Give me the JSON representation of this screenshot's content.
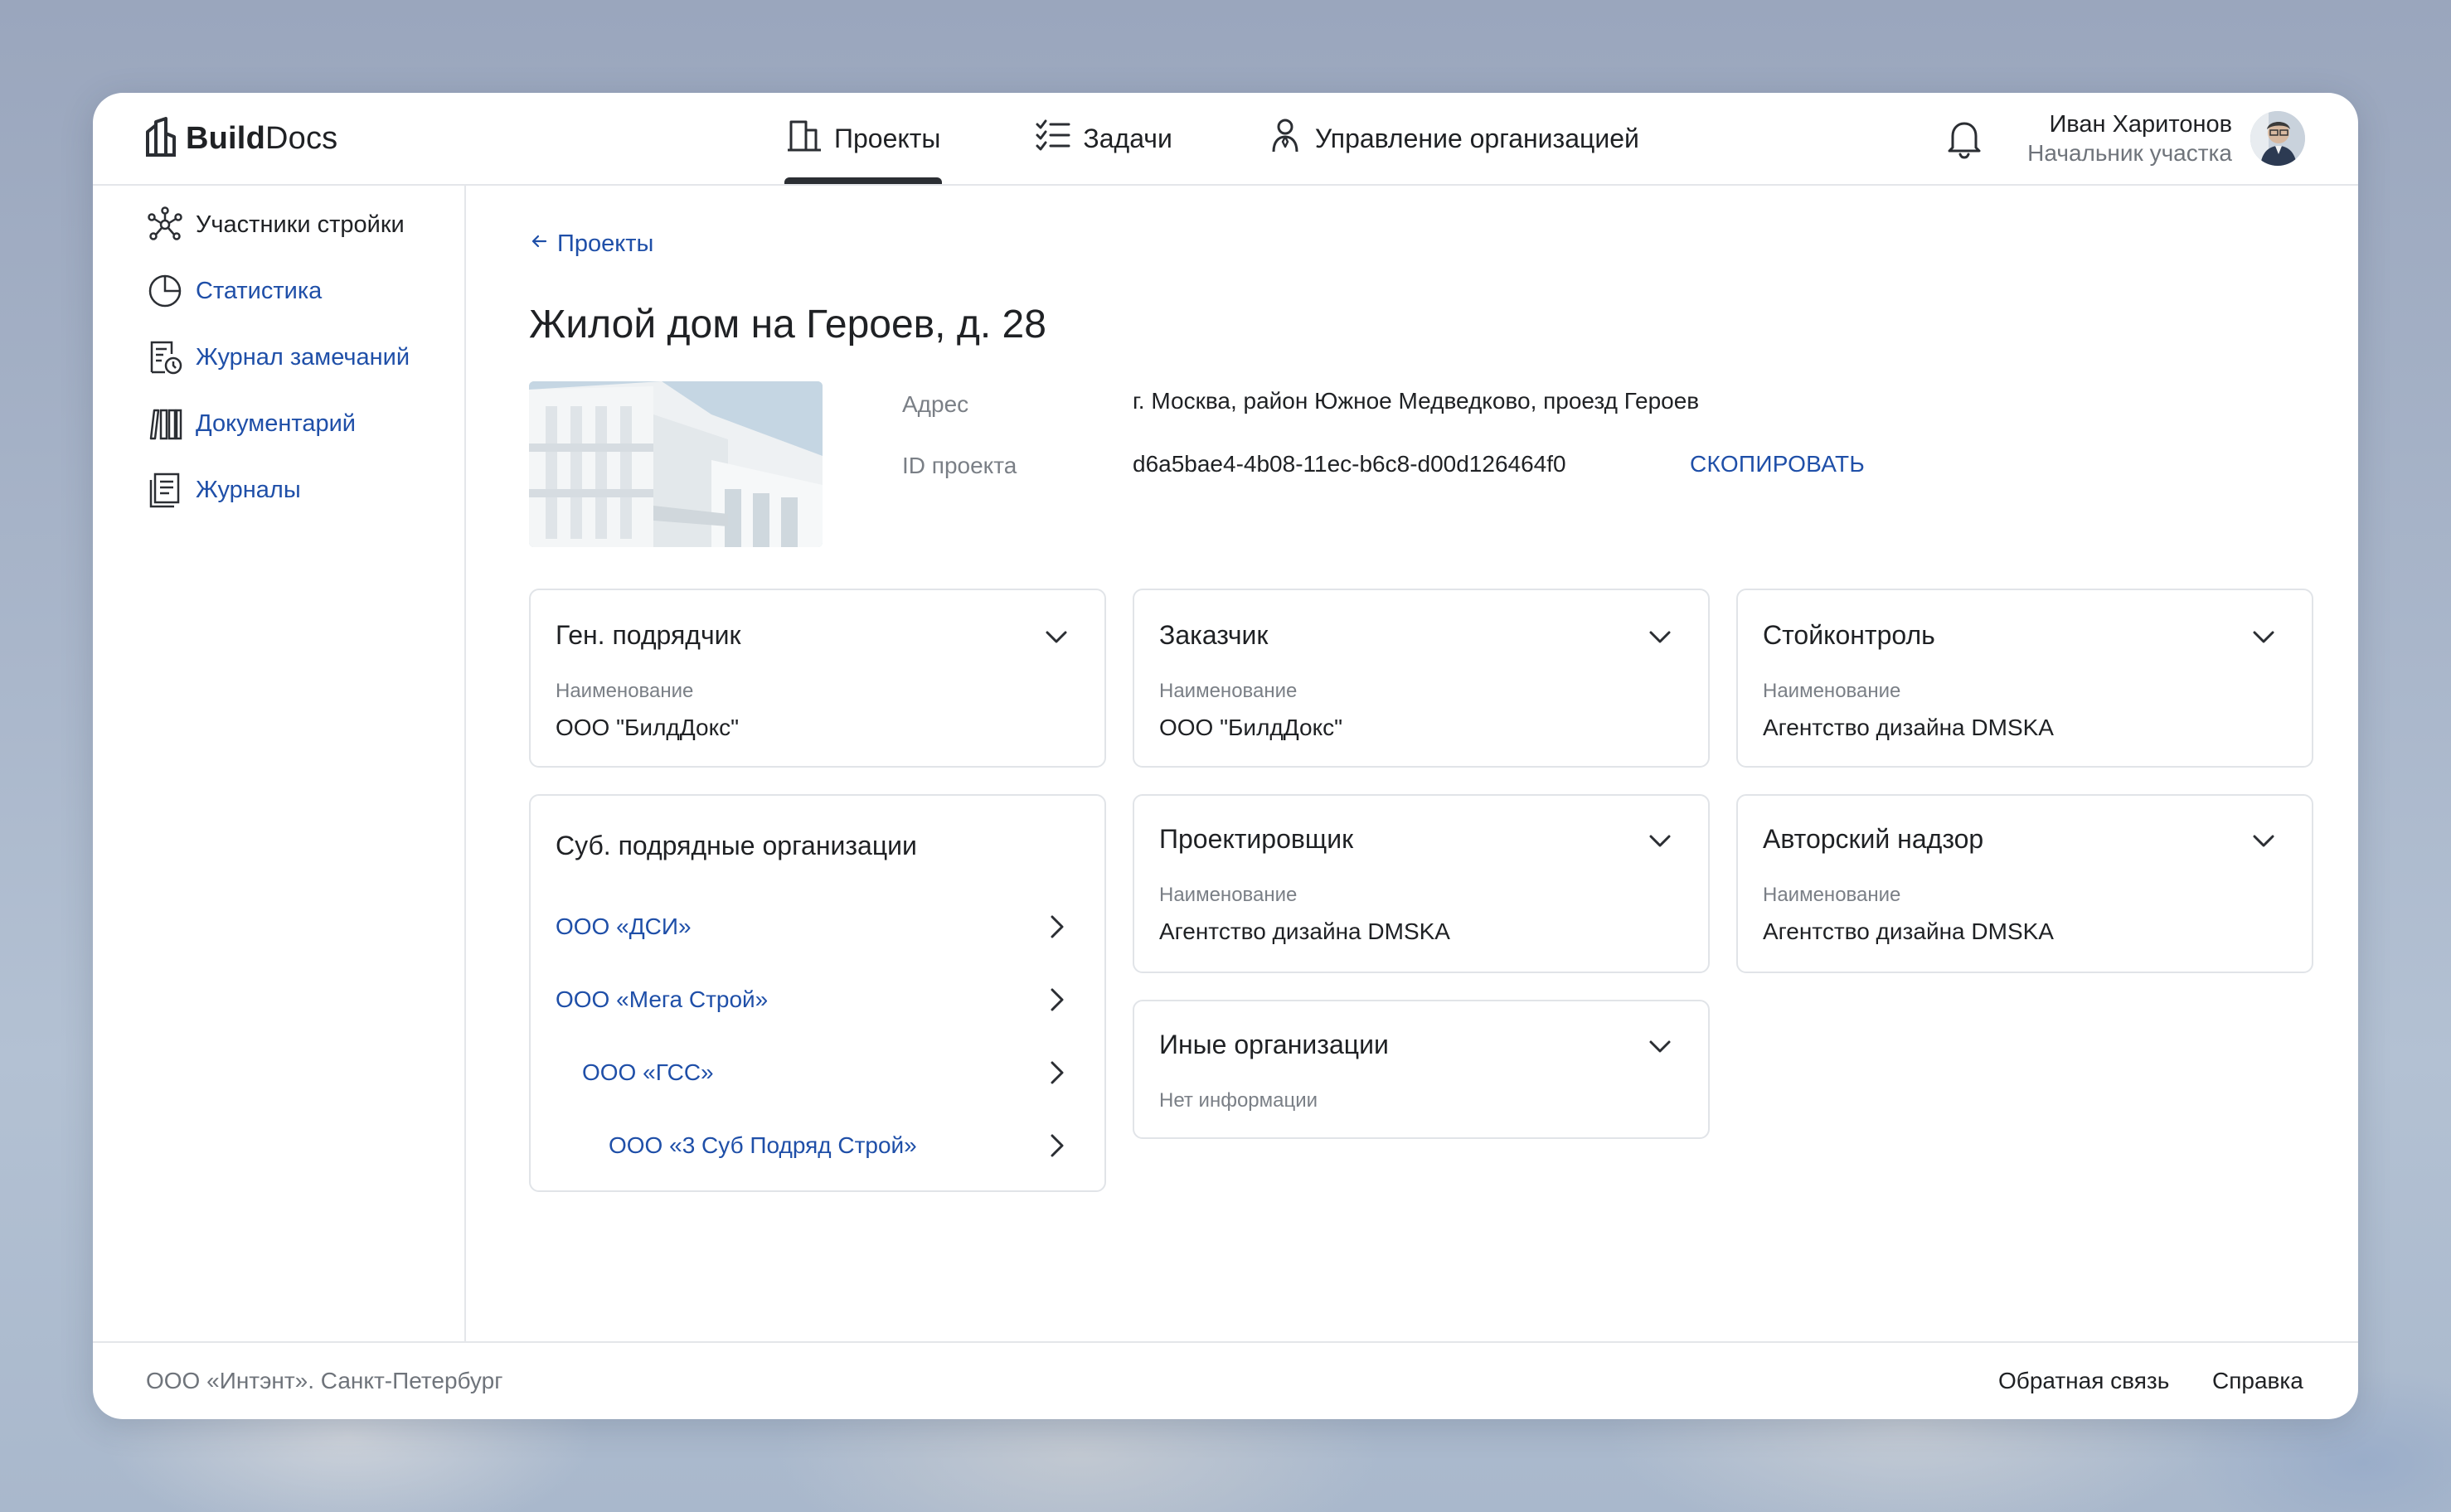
{
  "app": {
    "logo_bold": "Build",
    "logo_light": "Docs"
  },
  "nav": {
    "items": [
      {
        "label": "Проекты",
        "icon": "building-icon",
        "active": true
      },
      {
        "label": "Задачи",
        "icon": "checklist-icon",
        "active": false
      },
      {
        "label": "Управление организацией",
        "icon": "org-person-icon",
        "active": false
      }
    ]
  },
  "user": {
    "name": "Иван Харитонов",
    "role": "Начальник участка"
  },
  "sidebar": {
    "items": [
      {
        "label": "Участники стройки",
        "icon": "participants-icon"
      },
      {
        "label": "Статистика",
        "icon": "pie-chart-icon"
      },
      {
        "label": "Журнал замечаний",
        "icon": "remarks-log-icon"
      },
      {
        "label": "Документарий",
        "icon": "books-icon"
      },
      {
        "label": "Журналы",
        "icon": "journal-icon"
      }
    ]
  },
  "page": {
    "back_label": "Проекты",
    "title": "Жилой дом на Героев, д. 28",
    "address_label": "Адрес",
    "address_value": "г. Москва, район Южное Медведково, проезд Героев",
    "id_label": "ID проекта",
    "id_value": "d6a5bae4-4b08-11ec-b6c8-d00d126464f0",
    "copy_label": "СКОПИРОВАТЬ"
  },
  "cards": {
    "gen_contractor": {
      "title": "Ген. подрядчик",
      "label": "Наименование",
      "value": "ООО \"БилдДокс\""
    },
    "customer": {
      "title": "Заказчик",
      "label": "Наименование",
      "value": "ООО \"БилдДокс\""
    },
    "construction_control": {
      "title": "Стойконтроль",
      "label": "Наименование",
      "value": "Агентство дизайна DMSKA"
    },
    "designer": {
      "title": "Проектировщик",
      "label": "Наименование",
      "value": "Агентство дизайна DMSKA"
    },
    "author_supervision": {
      "title": "Авторский надзор",
      "label": "Наименование",
      "value": "Агентство дизайна DMSKA"
    },
    "other_orgs": {
      "title": "Иные организации",
      "empty": "Нет информации"
    },
    "sub_contractors": {
      "title": "Суб. подрядные организации",
      "items": [
        {
          "label": "ООО «ДСИ»"
        },
        {
          "label": "ООО «Мега Строй»"
        },
        {
          "label": "ООО «ГСС»"
        },
        {
          "label": "ООО «3 Суб Подряд Строй»"
        }
      ]
    }
  },
  "footer": {
    "company": "ООО «Интэнт». Санкт-Петербург",
    "feedback": "Обратная связь",
    "help": "Справка"
  },
  "colors": {
    "accent": "#1f4fa8",
    "text": "#1f2124",
    "muted": "#7a7f86",
    "border": "#e1e4e8"
  }
}
